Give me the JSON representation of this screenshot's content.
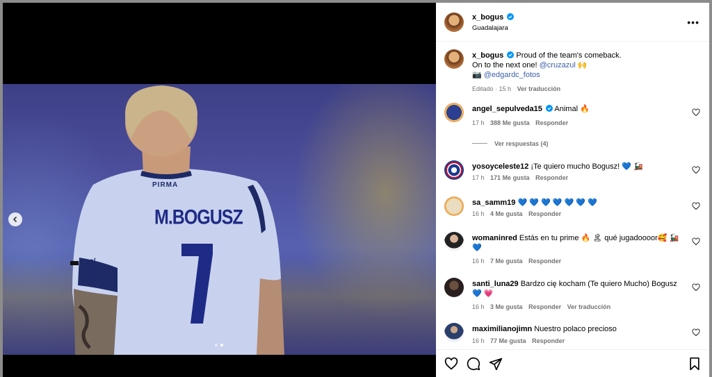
{
  "post": {
    "author": "x_bogus",
    "location": "Guadalajara",
    "caption_line1": "Proud of the team's comeback.",
    "caption_line2_prefix": "On to the next one!",
    "caption_mention": "@cruzazul",
    "caption_emoji": "🙌",
    "photo_credit_emoji": "📷",
    "photo_credit_mention": "@edgardc_fotos",
    "caption_meta": "Editado · 15 h",
    "translate_label": "Ver traducción",
    "more_label": "•••"
  },
  "photo": {
    "sponsor": "PIRMA",
    "name": "M.BOGUSZ",
    "number": "7",
    "sleeve": "gool"
  },
  "comments": [
    {
      "user": "angel_sepulveda15",
      "verified": true,
      "text": "Animal 🔥",
      "time": "17 h",
      "likes": "388 Me gusta",
      "reply": "Responder",
      "replies": "Ver respuestas (4)",
      "avatar_color": "#1c2f7a"
    },
    {
      "user": "yosoyceleste12",
      "text": "¡Te quiero mucho Bogusz! 💙 🚂",
      "time": "17 h",
      "likes": "171 Me gusta",
      "reply": "Responder",
      "avatar_color": "#1d3a8f"
    },
    {
      "user": "sa_samm19",
      "text": "💙 💙 💙 💙 💙 💙 💙",
      "time": "16 h",
      "likes": "4 Me gusta",
      "reply": "Responder",
      "avatar_color": "#d9c7a8"
    },
    {
      "user": "womaninred",
      "text": "Estás en tu prime 🔥 🏝 qué jugadoooor🥰 🚂 💙",
      "time": "16 h",
      "likes": "7 Me gusta",
      "reply": "Responder",
      "avatar_color": "#4a4a4a"
    },
    {
      "user": "santi_luna29",
      "text": "Bardzo cię kocham (Te quiero Mucho) Bogusz 💙 💗",
      "time": "16 h",
      "likes": "3 Me gusta",
      "reply": "Responder",
      "translate": "Ver traducción",
      "avatar_color": "#3a2a2a"
    },
    {
      "user": "maximilianojimn",
      "text": "Nuestro polaco precioso",
      "time": "16 h",
      "likes": "77 Me gusta",
      "reply": "Responder",
      "avatar_color": "#2a3f6b"
    }
  ],
  "icons": [
    "like-icon",
    "comment-icon",
    "share-icon",
    "save-icon",
    "verified-icon",
    "chevron-left-icon",
    "more-options-icon"
  ],
  "colors": {
    "verified": "#0095f6",
    "link": "#3a5ea8",
    "muted": "#737373"
  }
}
